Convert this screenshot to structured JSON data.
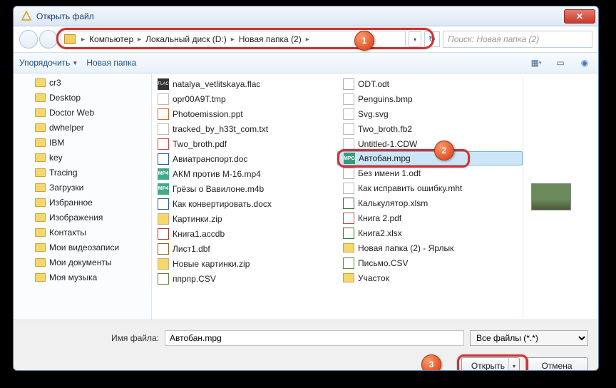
{
  "window": {
    "title": "Открыть файл"
  },
  "breadcrumb": {
    "parts": [
      "Компьютер",
      "Локальный диск (D:)",
      "Новая папка (2)"
    ]
  },
  "search": {
    "placeholder": "Поиск: Новая папка (2)"
  },
  "toolbar": {
    "organize": "Упорядочить",
    "newfolder": "Новая папка"
  },
  "sidebar": [
    "cr3",
    "Desktop",
    "Doctor Web",
    "dwhelper",
    "IBM",
    "key",
    "Tracing",
    "Загрузки",
    "Избранное",
    "Изображения",
    "Контакты",
    "Мои видеозаписи",
    "Мои документы",
    "Моя музыка"
  ],
  "files_col1": [
    {
      "n": "natalya_vetlitskaya.flac",
      "t": "flac"
    },
    {
      "n": "opr00A9T.tmp",
      "t": "generic"
    },
    {
      "n": "Photoemission.ppt",
      "t": "ppt"
    },
    {
      "n": "tracked_by_h33t_com.txt",
      "t": "txt"
    },
    {
      "n": "Two_broth.pdf",
      "t": "pdf"
    },
    {
      "n": "Авиатранспорт.doc",
      "t": "docx"
    },
    {
      "n": "АКМ против М-16.mp4",
      "t": "mp4"
    },
    {
      "n": "Грёзы о Вавилоне.m4b",
      "t": "mp4"
    },
    {
      "n": "Как конвертировать.docx",
      "t": "docx"
    },
    {
      "n": "Картинки.zip",
      "t": "zip"
    },
    {
      "n": "Книга1.accdb",
      "t": "accdb"
    },
    {
      "n": "Лист1.dbf",
      "t": "dbf"
    },
    {
      "n": "Новые картинки.zip",
      "t": "zip"
    },
    {
      "n": "ппрпр.CSV",
      "t": "csv"
    }
  ],
  "files_col2": [
    {
      "n": "ODT.odt",
      "t": "doc"
    },
    {
      "n": "Penguins.bmp",
      "t": "generic"
    },
    {
      "n": "Svg.svg",
      "t": "generic"
    },
    {
      "n": "Two_broth.fb2",
      "t": "generic"
    },
    {
      "n": "Untitled-1.CDW",
      "t": "generic"
    },
    {
      "n": "Автобан.mpg",
      "t": "mpg",
      "sel": true
    },
    {
      "n": "Без имени 1.odt",
      "t": "doc"
    },
    {
      "n": "Как исправить ошибку.mht",
      "t": "generic"
    },
    {
      "n": "Калькулятор.xlsm",
      "t": "xls"
    },
    {
      "n": "Книга 2.pdf",
      "t": "pdf"
    },
    {
      "n": "Книга2.xlsx",
      "t": "xls"
    },
    {
      "n": "Новая папка (2) - Ярлык",
      "t": "folder"
    },
    {
      "n": "Письмо.CSV",
      "t": "csv"
    },
    {
      "n": "Участок",
      "t": "folder"
    }
  ],
  "filename": {
    "label": "Имя файла:",
    "value": "Автобан.mpg"
  },
  "filter": {
    "value": "Все файлы (*.*)"
  },
  "buttons": {
    "open": "Открыть",
    "cancel": "Отмена"
  },
  "callouts": {
    "c1": "1",
    "c2": "2",
    "c3": "3"
  }
}
